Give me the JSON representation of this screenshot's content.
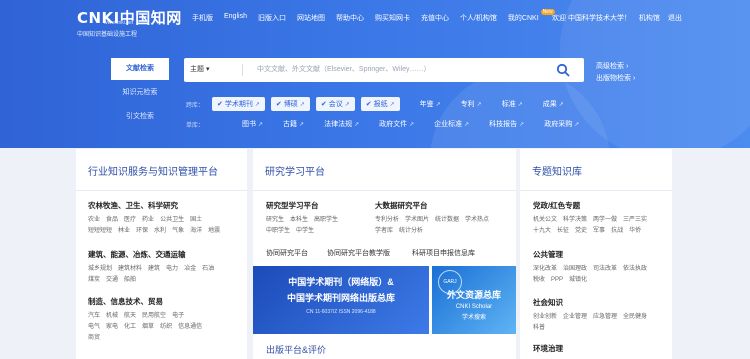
{
  "logo": {
    "name": "CNKI中国知网",
    "url": "www.cnki.net",
    "tagline": "中国知识基础设施工程"
  },
  "topnav": [
    "手机版",
    "English",
    "旧版入口",
    "网站地图",
    "帮助中心",
    "购买知网卡",
    "充值中心",
    "个人/机构馆",
    "我的CNKI"
  ],
  "topnav_badge": "New",
  "user": {
    "welcome": "欢迎 中国科学技术大学！",
    "org": "机构馆",
    "logout": "退出"
  },
  "search_types": [
    "文献检索",
    "知识元检索",
    "引文检索"
  ],
  "search": {
    "field": "主题",
    "placeholder": "中文文献、外文文献（Elsevier、Springer、Wiley……）"
  },
  "adv_links": [
    "高级检索",
    "出版物检索"
  ],
  "row1": {
    "label": "跨库：",
    "chips": [
      "学术期刊",
      "博硕",
      "会议",
      "报纸"
    ],
    "links": [
      "年鉴",
      "专利",
      "标准",
      "成果"
    ]
  },
  "row2": {
    "label": "单库：",
    "links": [
      "图书",
      "古籍",
      "法律法规",
      "政府文件",
      "企业标准",
      "科技报告",
      "政府采购"
    ]
  },
  "panels": {
    "left": {
      "title": "行业知识服务与知识管理平台",
      "groups": [
        {
          "title": "农林牧渔、卫生、科学研究",
          "items": [
            "农业",
            "食品",
            "医疗",
            "药业",
            "公共卫生",
            "国土",
            "短短短短",
            "林业",
            "环保",
            "水利",
            "气象",
            "海洋",
            "地震"
          ]
        },
        {
          "title": "建筑、能源、冶炼、交通运输",
          "items": [
            "城乡规划",
            "建筑材料",
            "建筑",
            "电力",
            "冶金",
            "石油",
            "煤炭",
            "交通",
            "船舶"
          ]
        },
        {
          "title": "制造、信息技术、贸易",
          "items": [
            "汽车",
            "机械",
            "航天",
            "民用航空",
            "电子",
            "电气",
            "家电",
            "化工",
            "烟草",
            "纺织",
            "信息通信",
            "商贸"
          ]
        }
      ]
    },
    "middle": {
      "title": "研究学习平台",
      "groups": [
        {
          "title": "研究型学习平台",
          "items": [
            "研究生",
            "本科生",
            "高职学生",
            "中职学生",
            "中学生"
          ]
        },
        {
          "title": "大数据研究平台",
          "items": [
            "专利分析",
            "学术图片",
            "统计数据",
            "学术热点",
            "学者库",
            "统计分析"
          ]
        }
      ],
      "links": [
        "协同研究平台",
        "协同研究平台教学版",
        "科研项目申报信息库"
      ],
      "banner1": {
        "line1": "中国学术期刊（网络版）&",
        "line2": "中国学术期刊网络出版总库",
        "line3": "CN 11-6037/Z   ISSN 2096-4188"
      },
      "banner2": {
        "badge": "GARJ",
        "line1": "外文资源总库",
        "line2": "CNKI Scholar",
        "line3": "学术搜索"
      },
      "bottom_title": "出版平台&评价"
    },
    "right": {
      "title": "专题知识库",
      "groups": [
        {
          "title": "党政/红色专题",
          "items": [
            "机关公文",
            "科学决策",
            "两学一做",
            "三严三实",
            "十九大",
            "长征",
            "党史",
            "军事",
            "抗战",
            "华侨"
          ]
        },
        {
          "title": "公共管理",
          "items": [
            "深化改革",
            "治国理政",
            "司法改革",
            "依法执政",
            "税收",
            "PPP",
            "城镇化"
          ]
        },
        {
          "title": "社会知识",
          "items": [
            "创业创新",
            "企业管理",
            "应急管理",
            "全民健身",
            "科普"
          ]
        },
        {
          "title": "环境治理",
          "items": []
        }
      ]
    }
  },
  "colors": {
    "hero": "#2f63d6",
    "accent": "#2f4fa8"
  }
}
